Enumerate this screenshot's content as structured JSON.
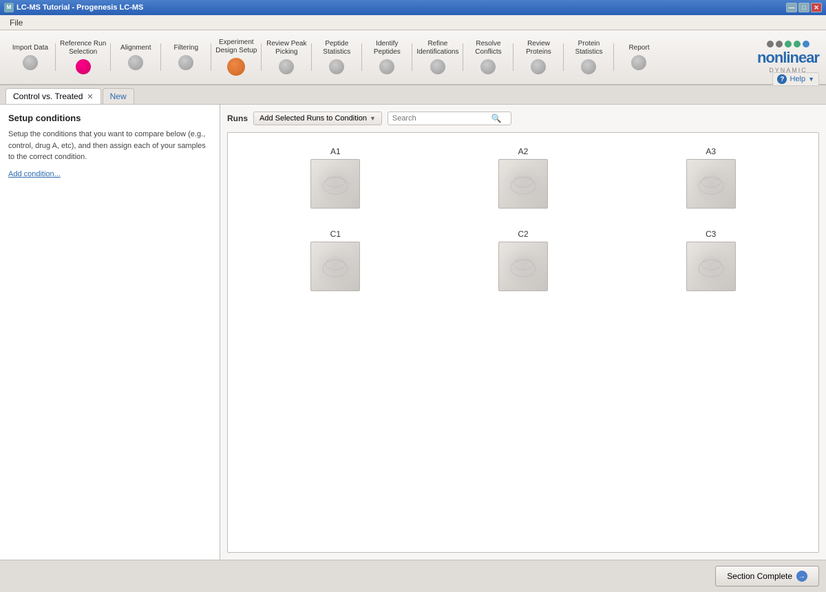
{
  "window": {
    "title": "LC-MS Tutorial - Progenesis LC-MS"
  },
  "titlebar": {
    "title": "LC-MS Tutorial - Progenesis LC-MS",
    "min_btn": "—",
    "max_btn": "□",
    "close_btn": "✕"
  },
  "menubar": {
    "items": [
      {
        "id": "file",
        "label": "File"
      }
    ]
  },
  "workflow": {
    "steps": [
      {
        "id": "import-data",
        "label": "Import Data",
        "state": "grey"
      },
      {
        "id": "reference-selection",
        "label": "Reference Run Selection",
        "state": "pink"
      },
      {
        "id": "alignment",
        "label": "Alignment",
        "state": "grey"
      },
      {
        "id": "filtering",
        "label": "Filtering",
        "state": "grey"
      },
      {
        "id": "experiment-design",
        "label": "Experiment Design Setup",
        "state": "active"
      },
      {
        "id": "review-peak",
        "label": "Review Peak Picking",
        "state": "grey"
      },
      {
        "id": "peptide-stats",
        "label": "Peptide Statistics",
        "state": "grey"
      },
      {
        "id": "identify-peptides",
        "label": "Identify Peptides",
        "state": "grey"
      },
      {
        "id": "refine-ids",
        "label": "Refine Identifications",
        "state": "grey"
      },
      {
        "id": "resolve-conflicts",
        "label": "Resolve Conflicts",
        "state": "grey"
      },
      {
        "id": "review-proteins",
        "label": "Review Proteins",
        "state": "grey"
      },
      {
        "id": "protein-stats",
        "label": "Protein Statistics",
        "state": "grey"
      },
      {
        "id": "report",
        "label": "Report",
        "state": "grey"
      }
    ]
  },
  "help_button": {
    "label": "Help",
    "icon": "?"
  },
  "logo": {
    "text": "nonlinear",
    "sub": "DYNAMIC",
    "dots": [
      "grey",
      "grey",
      "green",
      "green",
      "blue"
    ]
  },
  "tabs": [
    {
      "id": "control-treated",
      "label": "Control vs. Treated",
      "active": true,
      "closable": true
    },
    {
      "id": "new",
      "label": "New",
      "active": false,
      "closable": false
    }
  ],
  "left_panel": {
    "heading": "Setup conditions",
    "description": "Setup the conditions that you want to compare below (e.g., control, drug A, etc), and then assign each of your samples to the correct condition.",
    "add_condition_label": "Add condition..."
  },
  "runs_section": {
    "label": "Runs",
    "add_button_label": "Add Selected Runs to Condition",
    "search_placeholder": "Search",
    "items": [
      {
        "id": "A1",
        "label": "A1"
      },
      {
        "id": "A2",
        "label": "A2"
      },
      {
        "id": "A3",
        "label": "A3"
      },
      {
        "id": "C1",
        "label": "C1"
      },
      {
        "id": "C2",
        "label": "C2"
      },
      {
        "id": "C3",
        "label": "C3"
      }
    ]
  },
  "bottom_bar": {
    "section_complete_label": "Section Complete",
    "arrow": "→"
  }
}
